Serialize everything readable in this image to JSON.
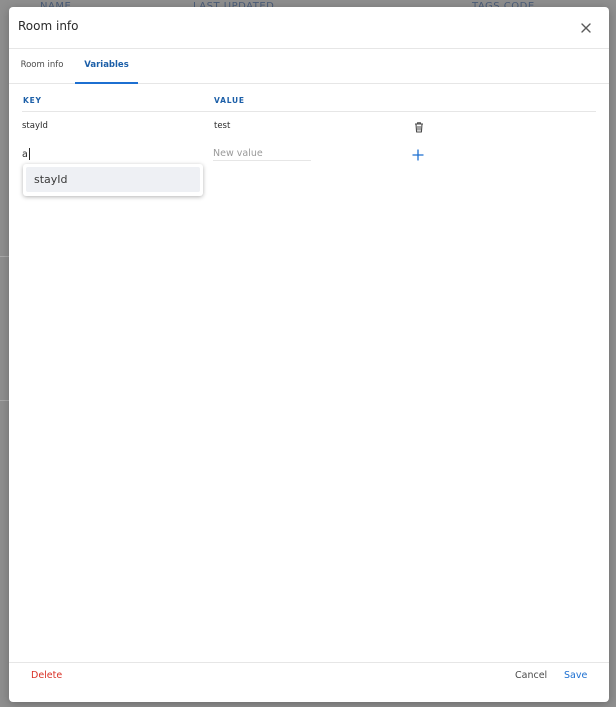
{
  "background": {
    "text_1": "NAME",
    "text_2": "LAST UPDATED",
    "text_3": "TAGS CODE"
  },
  "dialog": {
    "title": "Room info"
  },
  "tabs": [
    {
      "label": "Room info",
      "active": false
    },
    {
      "label": "Variables",
      "active": true
    }
  ],
  "table": {
    "columns": [
      "KEY",
      "VALUE"
    ],
    "rows": [
      {
        "key": "stayId",
        "value": "test"
      }
    ]
  },
  "new_row": {
    "key_value": "a",
    "value_placeholder": "New value"
  },
  "autocomplete": {
    "options": [
      "stayId"
    ]
  },
  "footer": {
    "delete_label": "Delete",
    "cancel_label": "Cancel",
    "save_label": "Save"
  },
  "colors": {
    "accent": "#1c6fd1",
    "danger": "#d93025"
  },
  "icons": {
    "close": "close-icon",
    "delete_row": "trash-icon",
    "add_row": "plus-icon"
  }
}
